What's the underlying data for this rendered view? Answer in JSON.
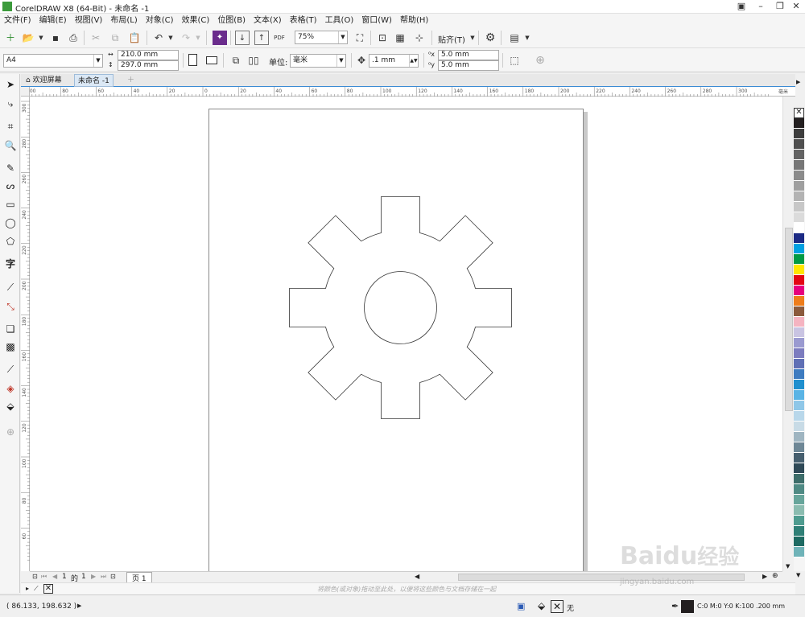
{
  "app": {
    "title": "CorelDRAW X8 (64-Bit) - 未命名 -1"
  },
  "menu": [
    "文件(F)",
    "编辑(E)",
    "视图(V)",
    "布局(L)",
    "对象(C)",
    "效果(C)",
    "位图(B)",
    "文本(X)",
    "表格(T)",
    "工具(O)",
    "窗口(W)",
    "帮助(H)"
  ],
  "toolbar": {
    "zoom_value": "75%",
    "snap_label": "贴齐(T)",
    "pdf_label": "PDF"
  },
  "property_bar": {
    "page_size": "A4",
    "width": "210.0 mm",
    "height": "297.0 mm",
    "unit_label": "单位:",
    "unit_value": "毫米",
    "nudge": ".1 mm",
    "dup_x": "5.0 mm",
    "dup_y": "5.0 mm"
  },
  "tabs": {
    "welcome": "欢迎屏幕",
    "document": "未命名 -1"
  },
  "ruler": {
    "unit": "毫米",
    "h_labels": [
      "100",
      "80",
      "60",
      "40",
      "20",
      "0",
      "20",
      "40",
      "60",
      "80",
      "100",
      "120",
      "140",
      "160",
      "180",
      "200",
      "220",
      "240",
      "260",
      "280",
      "300"
    ],
    "v_labels": [
      "300",
      "280",
      "260",
      "240",
      "220",
      "200",
      "180",
      "160",
      "140",
      "120",
      "100",
      "80",
      "60"
    ]
  },
  "page_nav": {
    "current": "1",
    "of_label": "的",
    "total": "1",
    "page_tab": "页 1"
  },
  "doc_palette_hint": "将颜色(或对象)拖动至此处，以便将这些颜色与文档存储在一起",
  "status": {
    "coords": "( 86.133, 198.632 )",
    "fill_label": "无",
    "outline_info": "C:0 M:0 Y:0 K:100  .200 mm"
  },
  "palette_colors": [
    "#231f20",
    "#3d3d3d",
    "#4f4f4f",
    "#636363",
    "#777777",
    "#8b8b8b",
    "#9f9f9f",
    "#b3b3b3",
    "#c7c7c7",
    "#dbdbdb",
    "#ffffff",
    "#1c2a84",
    "#00a0e1",
    "#009a44",
    "#ffe600",
    "#e30613",
    "#e6007e",
    "#ee7d1b",
    "#8b5a3c",
    "#f5b4c1",
    "#c9c4e2",
    "#9a9ad0",
    "#7c7cbf",
    "#5f6fb5",
    "#3d7bc0",
    "#1f8fce",
    "#5ab4e5",
    "#8fc7e8",
    "#b8d7ea",
    "#c8dbe6",
    "#9fb5c1",
    "#6e8796",
    "#465f6f",
    "#2f4957",
    "#3d6d6a",
    "#4f8a84",
    "#67a59b",
    "#8bbcb0",
    "#4e9b8f",
    "#2f7f76",
    "#1d6a62",
    "#6fb3b8"
  ],
  "watermark": {
    "brand": "Baidu",
    "cn": "经验",
    "url": "jingyan.baidu.com"
  }
}
